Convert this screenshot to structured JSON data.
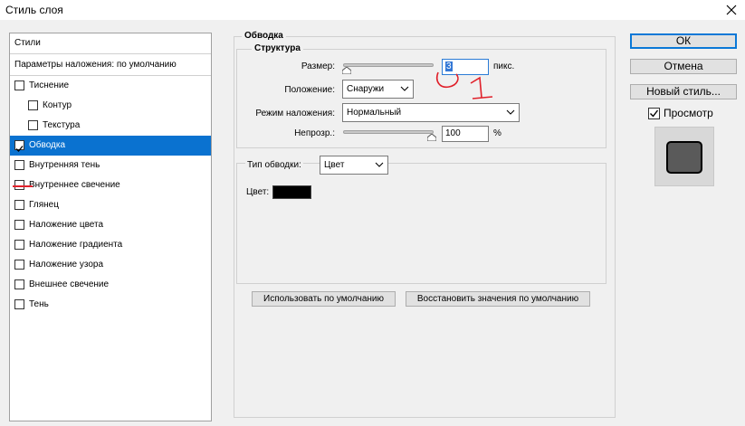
{
  "window": {
    "title": "Стиль слоя"
  },
  "styles_panel": {
    "header": "Стили",
    "blend_default": "Параметры наложения: по умолчанию",
    "items": [
      {
        "label": "Тиснение",
        "checked": false,
        "indent": false
      },
      {
        "label": "Контур",
        "checked": false,
        "indent": true
      },
      {
        "label": "Текстура",
        "checked": false,
        "indent": true
      },
      {
        "label": "Обводка",
        "checked": true,
        "indent": false,
        "selected": true
      },
      {
        "label": "Внутренняя тень",
        "checked": false,
        "indent": false
      },
      {
        "label": "Внутреннее свечение",
        "checked": false,
        "indent": false
      },
      {
        "label": "Глянец",
        "checked": false,
        "indent": false
      },
      {
        "label": "Наложение цвета",
        "checked": false,
        "indent": false
      },
      {
        "label": "Наложение градиента",
        "checked": false,
        "indent": false
      },
      {
        "label": "Наложение узора",
        "checked": false,
        "indent": false
      },
      {
        "label": "Внешнее свечение",
        "checked": false,
        "indent": false
      },
      {
        "label": "Тень",
        "checked": false,
        "indent": false
      }
    ]
  },
  "stroke": {
    "section_title": "Обводка",
    "structure_title": "Структура",
    "size_label": "Размер:",
    "size_value": "3",
    "size_unit": "пикс.",
    "position_label": "Положение:",
    "position_value": "Снаружи",
    "blend_label": "Режим наложения:",
    "blend_value": "Нормальный",
    "opacity_label": "Непрозр.:",
    "opacity_value": "100",
    "opacity_unit": "%",
    "fill_type_label": "Тип обводки:",
    "fill_type_value": "Цвет",
    "color_label": "Цвет:",
    "color_value": "#000000",
    "make_default_label": "Использовать по умолчанию",
    "reset_default_label": "Восстановить значения по умолчанию"
  },
  "actions": {
    "ok_label": "ОК",
    "cancel_label": "Отмена",
    "new_style_label": "Новый стиль...",
    "preview_label": "Просмотр",
    "preview_checked": true
  },
  "colors": {
    "accent": "#0a72d0",
    "annotation": "#e0202a"
  },
  "icons": {
    "close": "close-icon",
    "dropdown": "chevron-down-icon",
    "checkbox": "checkbox-icon"
  }
}
